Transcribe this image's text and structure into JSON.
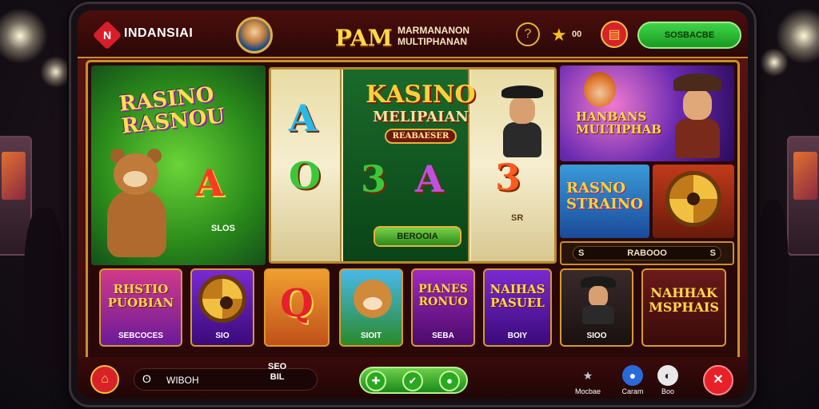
{
  "topbar": {
    "brand": "INDANSIAI",
    "logo_letter": "N",
    "title_main": "PAM",
    "title_sub_1": "MARMANANON",
    "title_sub_2": "MULTIPHANAN",
    "star_value": "00",
    "green_button": "SOSBACBE"
  },
  "panels": {
    "left": {
      "title_1": "RASINO",
      "title_2": "RASNOU",
      "symbol": "A",
      "label": "SLOS"
    },
    "center": {
      "title_1": "KASINO",
      "title_2": "MELIPAIAN",
      "badge": "REABAESER",
      "reel_symbols": [
        "A",
        "O",
        "3",
        "A",
        "3"
      ],
      "reel_label": "SR",
      "spin_label": "BEROOIA"
    },
    "top_right": {
      "title_1": "HANBANS",
      "title_2": "MULTIPHAB"
    },
    "rasino_strain": {
      "title_1": "RASNO",
      "title_2": "STRAINO"
    },
    "bar_label": "RABOOO",
    "bar_left_icon": "S",
    "bar_right_icon": "S"
  },
  "tiles": [
    {
      "name": "RHSTIO PUOBIAN",
      "label": "SEBCOCES"
    },
    {
      "name": "",
      "label": "SIO"
    },
    {
      "name": "Q",
      "label": ""
    },
    {
      "name": "",
      "label": "SIOIT"
    },
    {
      "name": "PIANES RONUO",
      "label": "SEBA"
    },
    {
      "name": "NAIHAS PASUEL",
      "label": "BOIY"
    },
    {
      "name": "",
      "label": "SIOO"
    },
    {
      "name": "NAHHAK MSPHAIS",
      "label": ""
    }
  ],
  "bottombar": {
    "wallet_text": "WIBOH",
    "bet_line_1": "SEO",
    "bet_line_2": "BIL",
    "nav": [
      {
        "label": "Mocbae",
        "icon": "★"
      },
      {
        "label": "Caram",
        "icon": "●"
      },
      {
        "label": "Boo",
        "icon": "◐"
      }
    ],
    "close_icon": "✕"
  },
  "colors": {
    "accent_gold": "#c8902a",
    "brand_red": "#d81e2a",
    "green": "#2aa822"
  }
}
